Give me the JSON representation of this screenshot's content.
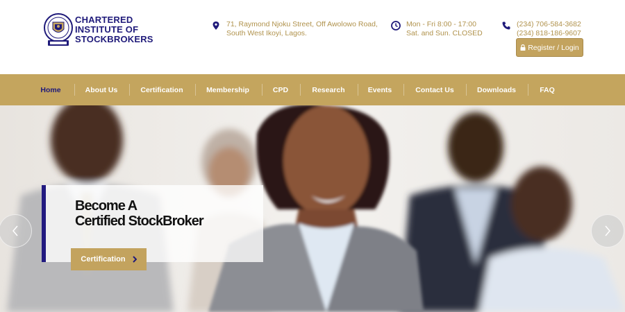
{
  "brand": {
    "name_lines": [
      "CHARTERED",
      "INSTITUTE OF",
      "STOCKBROKERS"
    ],
    "primary_color": "#1f1a7a",
    "gold_color": "#c4a55e"
  },
  "header": {
    "address": {
      "icon": "map-pin-icon",
      "lines": [
        "71, Raymond Njoku Street, Off Awolowo Road,",
        "South West Ikoyi, Lagos."
      ]
    },
    "hours": {
      "icon": "clock-icon",
      "lines": [
        "Mon - Fri 8:00 - 17:00",
        "Sat. and Sun. CLOSED"
      ]
    },
    "phone": {
      "icon": "phone-icon",
      "lines": [
        "(234) 706-584-3682",
        "(234) 818-186-9607"
      ]
    },
    "register_label": "Register / Login"
  },
  "nav": {
    "items": [
      {
        "label": "Home",
        "active": true
      },
      {
        "label": "About Us"
      },
      {
        "label": "Certification"
      },
      {
        "label": "Membership"
      },
      {
        "label": "CPD"
      },
      {
        "label": "Research"
      },
      {
        "label": "Events"
      },
      {
        "label": "Contact Us"
      },
      {
        "label": "Downloads"
      },
      {
        "label": "FAQ"
      }
    ]
  },
  "hero": {
    "title_lines": [
      "Become A",
      "Certified StockBroker"
    ],
    "cta_label": "Certification",
    "prev_icon": "chevron-left-icon",
    "next_icon": "chevron-right-icon"
  }
}
